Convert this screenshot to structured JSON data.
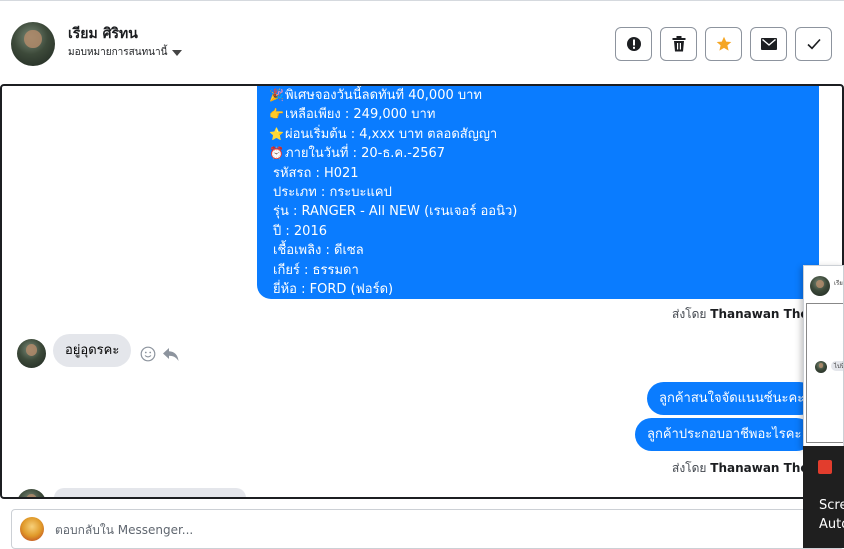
{
  "header": {
    "contact_name": "เรียม ศิริทน",
    "assign_label": "มอบหมายการสนทนานี้",
    "actions": [
      {
        "name": "mark-spam-button",
        "icon": "alert-circle-icon"
      },
      {
        "name": "delete-button",
        "icon": "trash-icon"
      },
      {
        "name": "star-button",
        "icon": "star-icon",
        "color": "#f5a623"
      },
      {
        "name": "mark-unread-button",
        "icon": "envelope-icon"
      },
      {
        "name": "mark-done-button",
        "icon": "check-icon"
      }
    ]
  },
  "thread": {
    "card_lines": [
      {
        "emoji": "🎉",
        "text": "พิเศษจองวันนี้ลดทันที 40,000 บาท"
      },
      {
        "emoji": "👉",
        "text": "เหลือเพียง : 249,000 บาท"
      },
      {
        "emoji": "⭐",
        "text": "ผ่อนเริ่มต้น : 4,xxx บาท ตลอดสัญญา"
      },
      {
        "emoji": "⏰",
        "text": "ภายในวันที่ : 20-ธ.ค.-2567"
      },
      {
        "emoji": "",
        "text": "รหัสรถ : H021"
      },
      {
        "emoji": "",
        "text": "ประเภท : กระบะแคป"
      },
      {
        "emoji": "",
        "text": "รุ่น : RANGER - All NEW (เรนเจอร์ ออนิว)"
      },
      {
        "emoji": "",
        "text": "ปี : 2016"
      },
      {
        "emoji": "",
        "text": "เชื้อเพลิง : ดีเซล"
      },
      {
        "emoji": "",
        "text": "เกียร์ : ธรรมดา"
      },
      {
        "emoji": "",
        "text": "ยี่ห้อ : FORD (ฟอร์ด)"
      }
    ],
    "sent_by_prefix": "ส่งโดย",
    "sent_by_name_1": "Thanawan Thon",
    "incoming_message": "อยู่อุดรคะ",
    "outgoing_1": "ลูกค้าสนใจจัดแนนซ์นะคะ",
    "outgoing_2": "ลูกค้าประกอบอาชีพอะไรคะ",
    "sent_by_name_2": "Thanawan Thon"
  },
  "composer": {
    "placeholder": "ตอบกลับใน Messenger..."
  },
  "popup": {
    "title_fragment": "เรีย",
    "message_fragment": "ไปนี้"
  },
  "toast": {
    "line1": "Scre",
    "line2": "Auto"
  }
}
